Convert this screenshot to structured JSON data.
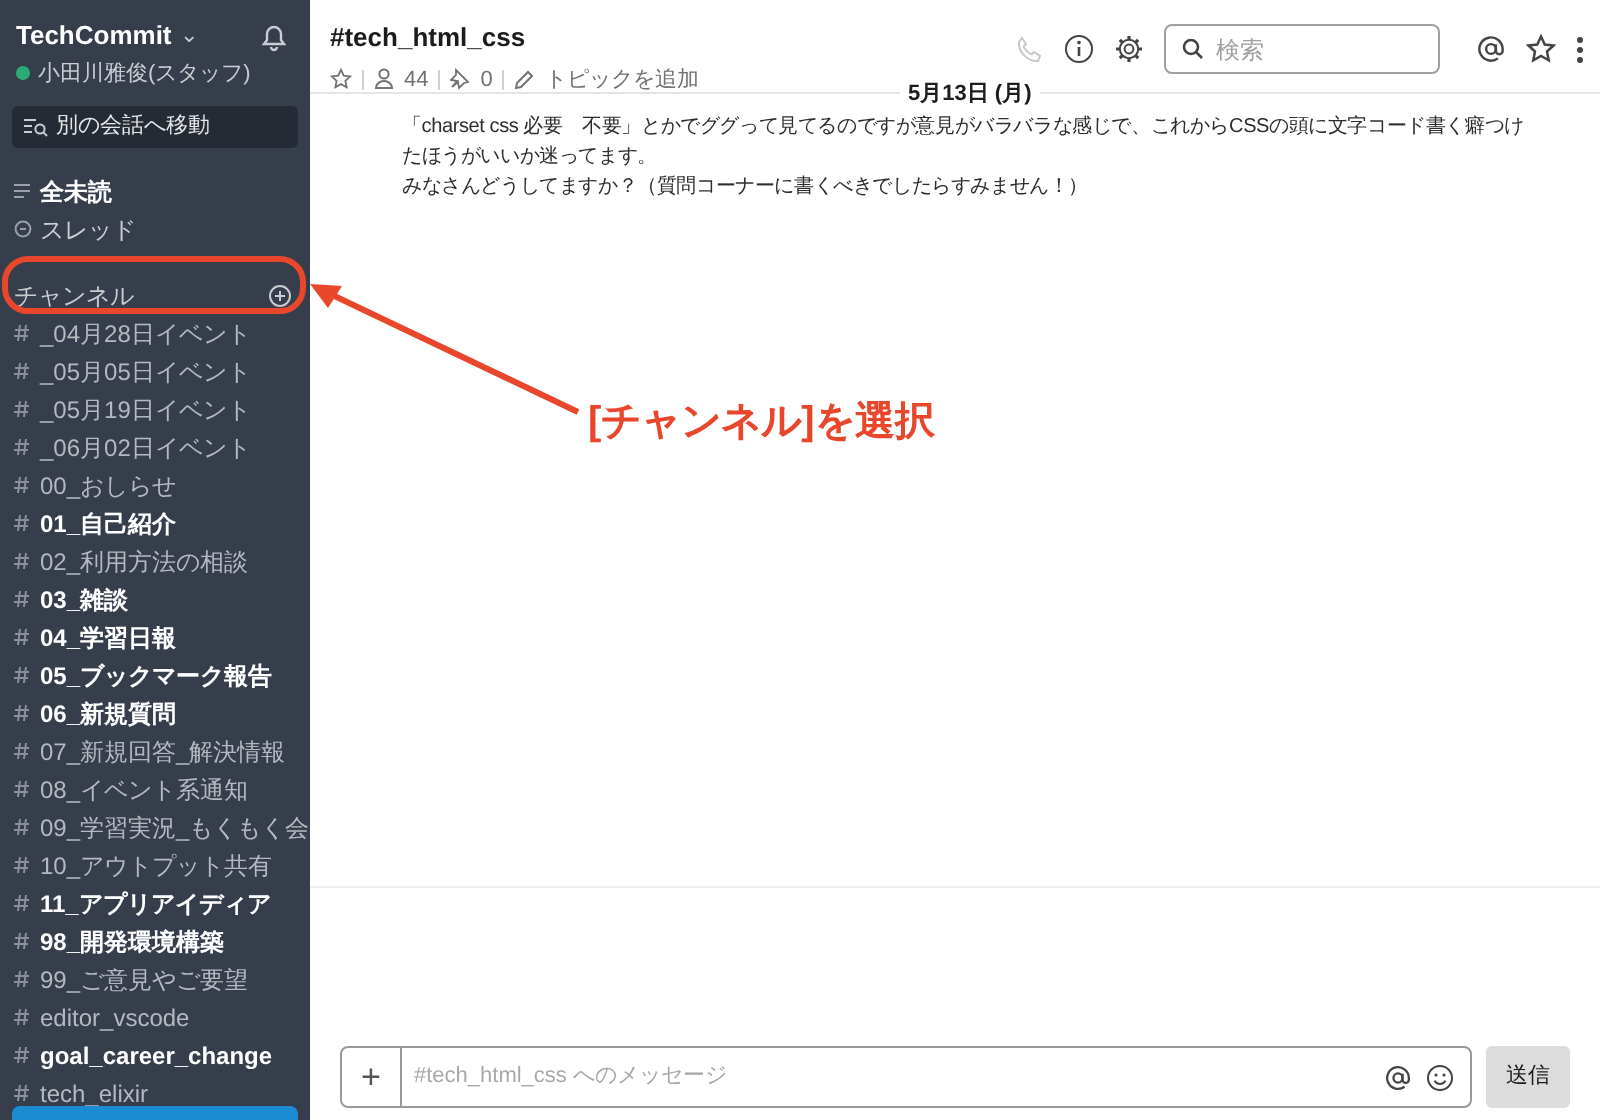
{
  "workspace": {
    "name": "TechCommit",
    "caret": "⌄",
    "user": "小田川雅俊(スタッフ)",
    "online": true
  },
  "jump_button": "別の会話へ移動",
  "nav": [
    {
      "label": "全未読",
      "kind": "unreads",
      "unread": true
    },
    {
      "label": "スレッド",
      "kind": "threads",
      "unread": false
    }
  ],
  "channels_header": "チャンネル",
  "channels": [
    {
      "name": "_04月28日イベント",
      "unread": false
    },
    {
      "name": "_05月05日イベント",
      "unread": false
    },
    {
      "name": "_05月19日イベント",
      "unread": false
    },
    {
      "name": "_06月02日イベント",
      "unread": false
    },
    {
      "name": "00_おしらせ",
      "unread": false
    },
    {
      "name": "01_自己紹介",
      "unread": true
    },
    {
      "name": "02_利用方法の相談",
      "unread": false
    },
    {
      "name": "03_雑談",
      "unread": true
    },
    {
      "name": "04_学習日報",
      "unread": true
    },
    {
      "name": "05_ブックマーク報告",
      "unread": true
    },
    {
      "name": "06_新規質問",
      "unread": true
    },
    {
      "name": "07_新規回答_解決情報",
      "unread": false
    },
    {
      "name": "08_イベント系通知",
      "unread": false
    },
    {
      "name": "09_学習実況_もくもく会",
      "unread": false
    },
    {
      "name": "10_アウトプット共有",
      "unread": false
    },
    {
      "name": "11_アプリアイディア",
      "unread": true
    },
    {
      "name": "98_開発環境構築",
      "unread": true
    },
    {
      "name": "99_ご意見やご要望",
      "unread": false
    },
    {
      "name": "editor_vscode",
      "unread": false
    },
    {
      "name": "goal_career_change",
      "unread": true
    },
    {
      "name": "tech_elixir",
      "unread": false
    }
  ],
  "header": {
    "channel": "#tech_html_css",
    "members": "44",
    "pins": "0",
    "topic": "トピックを追加",
    "search_placeholder": "検索"
  },
  "date_divider": "5月13日 (月)",
  "message_lines": [
    "「charset css 必要　不要」とかでググって見てるのですが意見がバラバラな感じで、これからCSSの頭に文字コード書く癖つけ",
    "たほうがいいか迷ってます。",
    "みなさんどうしてますか？（質問コーナーに書くべきでしたらすみません！）"
  ],
  "composer": {
    "plus": "+",
    "placeholder": "#tech_html_css へのメッセージ",
    "send": "送信"
  },
  "annotation": {
    "label": "[チャンネル]を選択"
  }
}
